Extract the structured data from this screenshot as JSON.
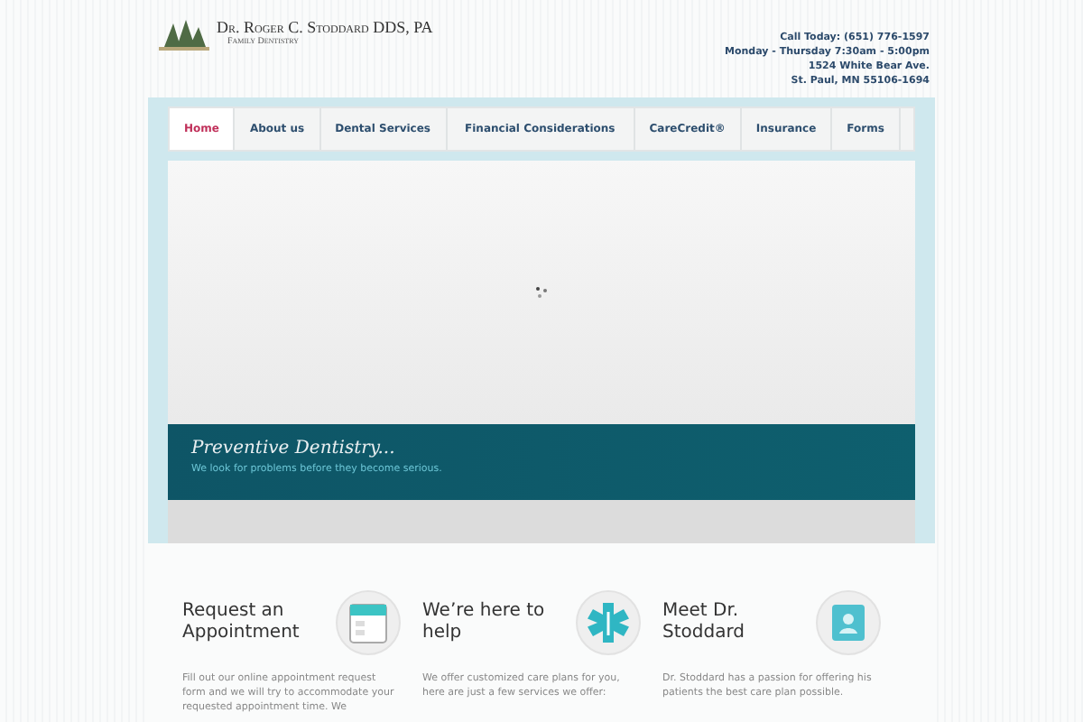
{
  "logo": {
    "name": "Dr. Roger C. Stoddard DDS, PA",
    "tagline": "Family Dentistry"
  },
  "contact": [
    "Call Today: (651) 776-1597",
    "Monday - Thursday 7:30am - 5:00pm",
    "1524 White Bear Ave.",
    "St. Paul, MN 55106-1694"
  ],
  "nav": [
    {
      "label": "Home",
      "selected": true
    },
    {
      "label": "About us",
      "selected": false
    },
    {
      "label": "Dental Services",
      "selected": false
    },
    {
      "label": "Financial Considerations",
      "selected": false
    },
    {
      "label": "CareCredit®",
      "selected": false
    },
    {
      "label": "Insurance",
      "selected": false
    },
    {
      "label": "Forms",
      "selected": false
    }
  ],
  "slide": {
    "title": "Preventive Dentistry...",
    "text": "We look for problems before they become serious."
  },
  "features": [
    {
      "kind": "calendar",
      "title": "Request an Appointment",
      "text": "Fill out our online appointment request form and we will try to accommodate your requested appointment time. We"
    },
    {
      "kind": "medical",
      "title": "We’re here to help",
      "text": "We offer customized care plans for you, here are just a few services we offer:"
    },
    {
      "kind": "book",
      "title": "Meet Dr. Stoddard",
      "text": "Dr. Stoddard has a passion for offering his patients the best care plan possible."
    }
  ]
}
